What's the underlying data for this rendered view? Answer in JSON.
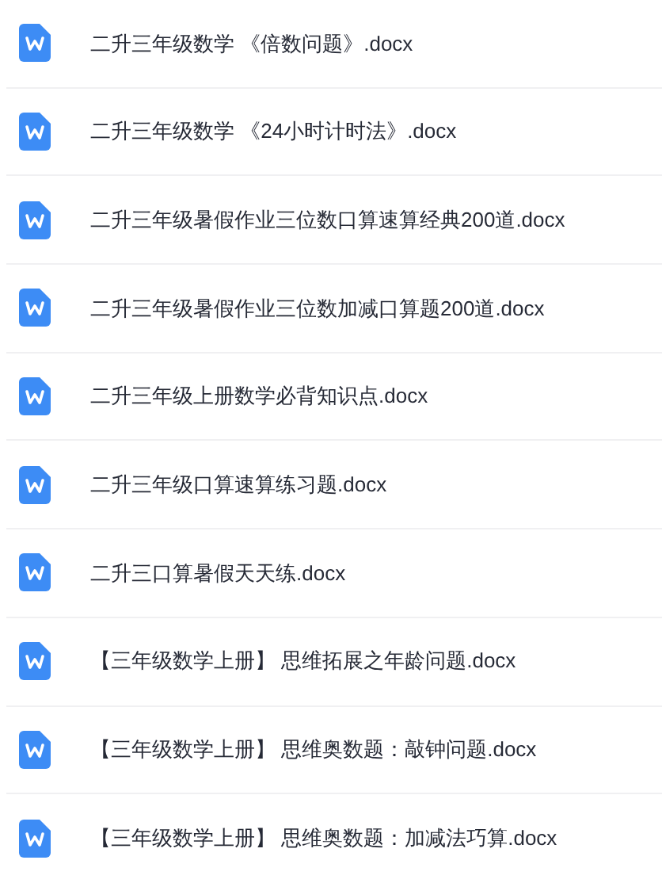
{
  "files": [
    {
      "name": "二升三年级数学 《倍数问题》.docx"
    },
    {
      "name": "二升三年级数学 《24小时计时法》.docx"
    },
    {
      "name": "二升三年级暑假作业三位数口算速算经典200道.docx"
    },
    {
      "name": "二升三年级暑假作业三位数加减口算题200道.docx"
    },
    {
      "name": "二升三年级上册数学必背知识点.docx"
    },
    {
      "name": "二升三年级口算速算练习题.docx"
    },
    {
      "name": "二升三口算暑假天天练.docx"
    },
    {
      "name": "【三年级数学上册】 思维拓展之年龄问题.docx"
    },
    {
      "name": "【三年级数学上册】 思维奥数题：敲钟问题.docx"
    },
    {
      "name": "【三年级数学上册】 思维奥数题：加减法巧算.docx"
    }
  ]
}
